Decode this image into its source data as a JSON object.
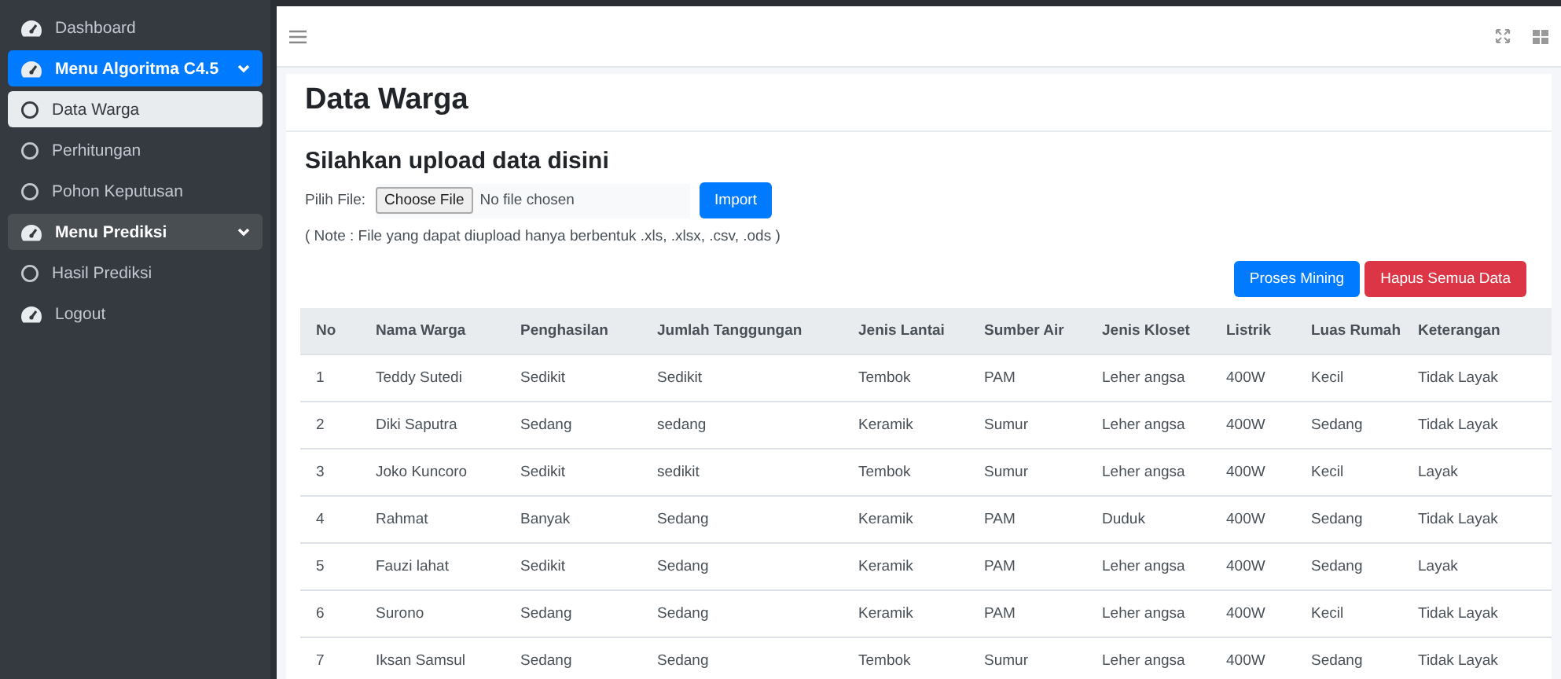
{
  "sidebar": {
    "items": [
      {
        "kind": "link",
        "label": "Dashboard"
      },
      {
        "kind": "menu",
        "label": "Menu Algoritma C4.5",
        "active": true
      },
      {
        "kind": "sub",
        "label": "Data Warga",
        "selected": true
      },
      {
        "kind": "sub",
        "label": "Perhitungan",
        "selected": false
      },
      {
        "kind": "sub",
        "label": "Pohon Keputusan",
        "selected": false
      },
      {
        "kind": "menu",
        "label": "Menu Prediksi",
        "active": false
      },
      {
        "kind": "sub",
        "label": "Hasil Prediksi",
        "selected": false
      },
      {
        "kind": "link",
        "label": "Logout"
      }
    ]
  },
  "page": {
    "title": "Data Warga"
  },
  "upload": {
    "heading": "Silahkan upload data disini",
    "file_label": "Pilih File:",
    "choose_button": "Choose File",
    "file_status": "No file chosen",
    "import_button": "Import",
    "note": "( Note : File yang dapat diupload hanya berbentuk .xls, .xlsx, .csv, .ods )"
  },
  "actions": [
    {
      "kind": "primary",
      "label": "Proses Mining"
    },
    {
      "kind": "danger",
      "label": "Hapus Semua Data"
    }
  ],
  "table": {
    "columns": [
      "No",
      "Nama Warga",
      "Penghasilan",
      "Jumlah Tanggungan",
      "Jenis Lantai",
      "Sumber Air",
      "Jenis Kloset",
      "Listrik",
      "Luas Rumah",
      "Keterangan"
    ],
    "rows": [
      [
        "1",
        "Teddy Sutedi",
        "Sedikit",
        "Sedikit",
        "Tembok",
        "PAM",
        "Leher angsa",
        "400W",
        "Kecil",
        "Tidak Layak"
      ],
      [
        "2",
        "Diki Saputra",
        "Sedang",
        "sedang",
        "Keramik",
        "Sumur",
        "Leher angsa",
        "400W",
        "Sedang",
        "Tidak Layak"
      ],
      [
        "3",
        "Joko Kuncoro",
        "Sedikit",
        "sedikit",
        "Tembok",
        "Sumur",
        "Leher angsa",
        "400W",
        "Kecil",
        "Layak"
      ],
      [
        "4",
        "Rahmat",
        "Banyak",
        "Sedang",
        "Keramik",
        "PAM",
        "Duduk",
        "400W",
        "Sedang",
        "Tidak Layak"
      ],
      [
        "5",
        "Fauzi lahat",
        "Sedikit",
        "Sedang",
        "Keramik",
        "PAM",
        "Leher angsa",
        "400W",
        "Sedang",
        "Layak"
      ],
      [
        "6",
        "Surono",
        "Sedang",
        "Sedang",
        "Keramik",
        "PAM",
        "Leher angsa",
        "400W",
        "Kecil",
        "Tidak Layak"
      ],
      [
        "7",
        "Iksan Samsul",
        "Sedang",
        "Sedang",
        "Tembok",
        "Sumur",
        "Leher angsa",
        "400W",
        "Sedang",
        "Tidak Layak"
      ]
    ]
  }
}
